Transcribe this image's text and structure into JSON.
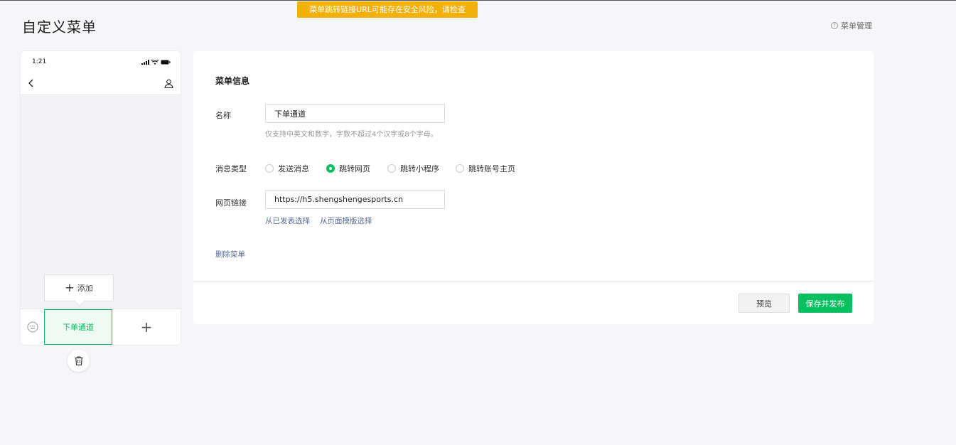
{
  "warning": "菜单跳转链接URL可能存在安全风险，请检查",
  "page_title": "自定义菜单",
  "help_link": "菜单管理",
  "phone": {
    "time": "1:21",
    "add_label": "添加",
    "menu_item": "下单通道",
    "add_symbol": "+"
  },
  "editor": {
    "section_title": "菜单信息",
    "name_label": "名称",
    "name_value": "下单通道",
    "name_hint": "仅支持中英文和数字，字数不超过4个汉字或8个字母。",
    "type_label": "消息类型",
    "types": [
      {
        "label": "发送消息",
        "checked": false
      },
      {
        "label": "跳转网页",
        "checked": true
      },
      {
        "label": "跳转小程序",
        "checked": false
      },
      {
        "label": "跳转账号主页",
        "checked": false
      }
    ],
    "url_label": "网页链接",
    "url_value": "https://h5.shengshengesports.cn",
    "link_published": "从已发表选择",
    "link_template": "从页面模版选择",
    "delete_label": "删除菜单",
    "preview_button": "预览",
    "save_button": "保存并发布"
  },
  "colors": {
    "accent": "#07c160",
    "warning": "#f2b10a",
    "link": "#576b95"
  }
}
